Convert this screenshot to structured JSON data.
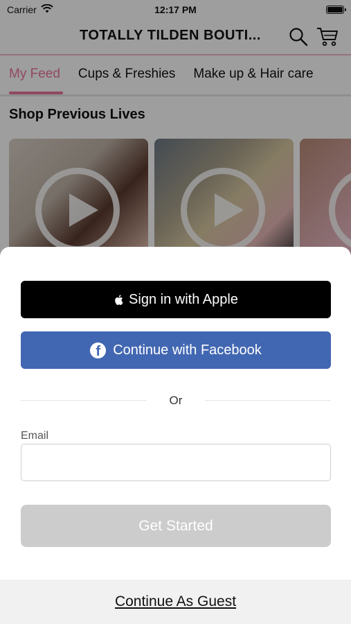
{
  "status_bar": {
    "carrier": "Carrier",
    "time": "12:17 PM",
    "icons": [
      "wifi-icon",
      "battery-icon"
    ]
  },
  "header": {
    "title": "TOTALLY TILDEN BOUTI...",
    "icons": [
      "search-icon",
      "cart-icon"
    ],
    "accent_color": "#f3b8c9"
  },
  "tabs": [
    {
      "label": "My Feed",
      "active": true
    },
    {
      "label": "Cups & Freshies",
      "active": false
    },
    {
      "label": "Make up & Hair care",
      "active": false
    }
  ],
  "tab_active_color": "#e8749b",
  "section": {
    "title": "Shop Previous Lives",
    "videos": [
      {
        "icon": "play-icon"
      },
      {
        "icon": "play-icon"
      },
      {
        "icon": "play-icon"
      }
    ]
  },
  "sheet": {
    "apple_button": {
      "label": "Sign in with Apple",
      "icon": "apple-icon",
      "color": "#000000"
    },
    "facebook_button": {
      "label": "Continue with Facebook",
      "icon": "facebook-icon",
      "color": "#4267b2"
    },
    "divider_text": "Or",
    "email": {
      "label": "Email",
      "value": "",
      "placeholder": ""
    },
    "get_started_button": {
      "label": "Get Started",
      "enabled": false,
      "color": "#cccccc"
    },
    "guest_link": "Continue As Guest"
  }
}
